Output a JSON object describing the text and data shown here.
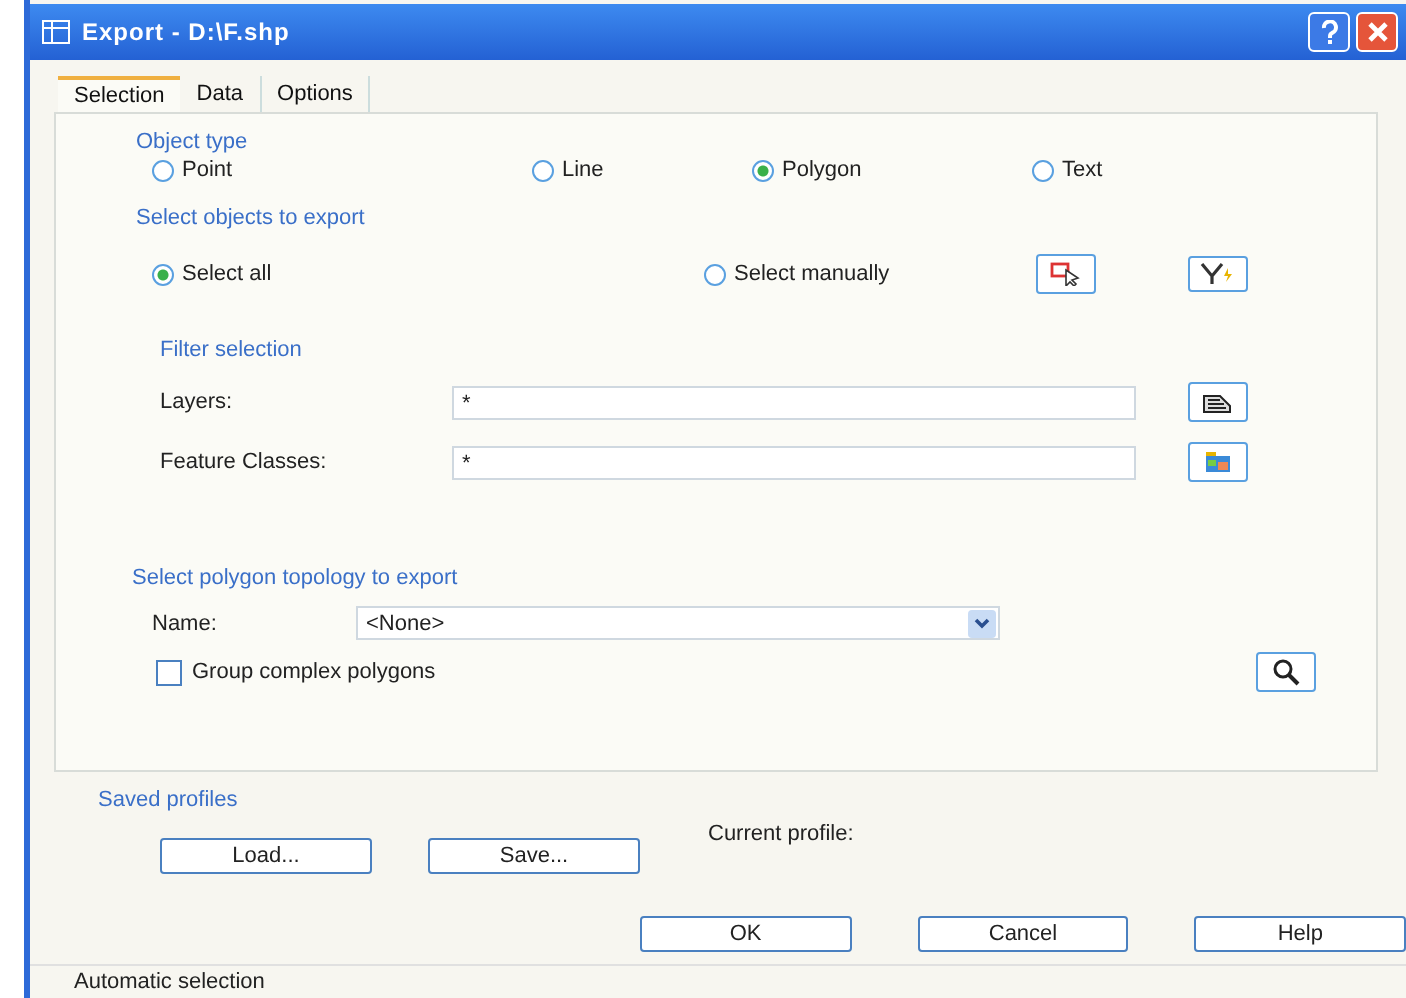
{
  "window": {
    "title": "Export - D:\\F.shp"
  },
  "tabs": [
    {
      "label": "Selection",
      "selected": true
    },
    {
      "label": "Data",
      "selected": false
    },
    {
      "label": "Options",
      "selected": false
    }
  ],
  "object_type": {
    "label": "Object type",
    "options": [
      {
        "label": "Point",
        "selected": false
      },
      {
        "label": "Line",
        "selected": false
      },
      {
        "label": "Polygon",
        "selected": true
      },
      {
        "label": "Text",
        "selected": false
      }
    ]
  },
  "select_objects": {
    "label": "Select objects to export",
    "options": [
      {
        "label": "Select all",
        "selected": true
      },
      {
        "label": "Select manually",
        "selected": false
      }
    ]
  },
  "filter": {
    "label": "Filter selection",
    "fields": [
      {
        "label": "Layers:",
        "value": "*"
      },
      {
        "label": "Feature Classes:",
        "value": "*"
      }
    ]
  },
  "topology": {
    "label": "Select polygon topology to export",
    "name_label": "Name:",
    "name_value": "<None>",
    "group_label": "Group complex polygons",
    "group_checked": false
  },
  "profiles": {
    "label": "Saved profiles",
    "buttons": [
      "Load...",
      "Save..."
    ],
    "current_label": "Current profile:"
  },
  "buttons": [
    "OK",
    "Cancel",
    "Help"
  ],
  "status_bar": "Automatic selection"
}
